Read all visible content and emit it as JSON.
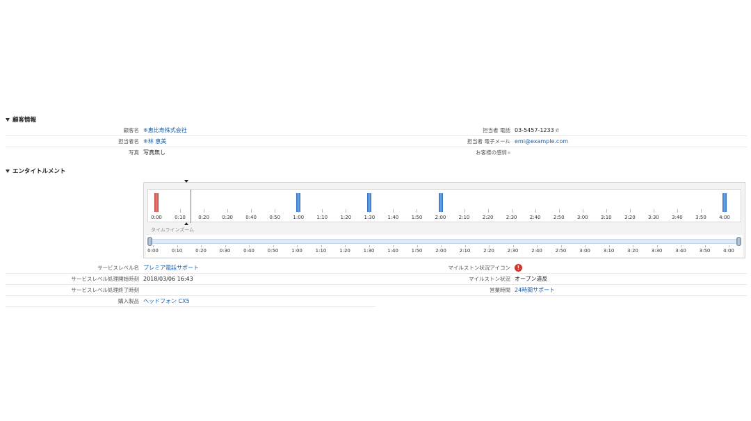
{
  "customer_section": {
    "title": "顧客情報",
    "rows": [
      {
        "label": "顧客名",
        "value": "※恵比寿株式会社",
        "right_label": "担当者 電話",
        "right_value": "03-5457-1233"
      },
      {
        "label": "担当者名",
        "value": "※林 恵美",
        "right_label": "担当者 電子メール",
        "right_value": "emi@example.com"
      },
      {
        "label": "写真",
        "value": "写真無し",
        "right_label": "お客様の感情",
        "right_value": ""
      }
    ]
  },
  "entitlement_section": {
    "title": "エンタイトルメント"
  },
  "timeline": {
    "labels": [
      "0:00",
      "0:10",
      "0:20",
      "0:30",
      "0:40",
      "0:50",
      "1:00",
      "1:10",
      "1:20",
      "1:30",
      "1:40",
      "1:50",
      "2:00",
      "2:10",
      "2:20",
      "2:30",
      "2:40",
      "2:50",
      "3:00",
      "3:10",
      "3:20",
      "3:30",
      "3:40",
      "3:50",
      "4:00"
    ],
    "zoom_label": "タイムラインズーム",
    "markers": [
      {
        "time_min": 0,
        "color": "red"
      },
      {
        "time_min": 60,
        "color": "blue"
      },
      {
        "time_min": 90,
        "color": "blue"
      },
      {
        "time_min": 120,
        "color": "blue"
      },
      {
        "time_min": 240,
        "color": "blue"
      }
    ],
    "cursor_time_min": 10
  },
  "service_section": {
    "rows": [
      {
        "label": "サービスレベル名",
        "value": "プレミア電話サポート",
        "right_label": "マイルストン状況アイコン",
        "right_value": "!"
      },
      {
        "label": "サービスレベル処理開始時刻",
        "value": "2018/03/06 16:43",
        "right_label": "マイルストン状況",
        "right_value": "オープン違反"
      },
      {
        "label": "サービスレベル処理終了時刻",
        "value": "",
        "right_label": "営業時間",
        "right_value": "24時間サポート"
      },
      {
        "label": "購入製品",
        "value": "ヘッドフォン CX5",
        "right_label": "",
        "right_value": ""
      }
    ]
  },
  "colors": {
    "link": "#1a5fa8",
    "bar_red": "#c0413b",
    "bar_blue": "#2a6fc0",
    "alert": "#d0342c"
  }
}
